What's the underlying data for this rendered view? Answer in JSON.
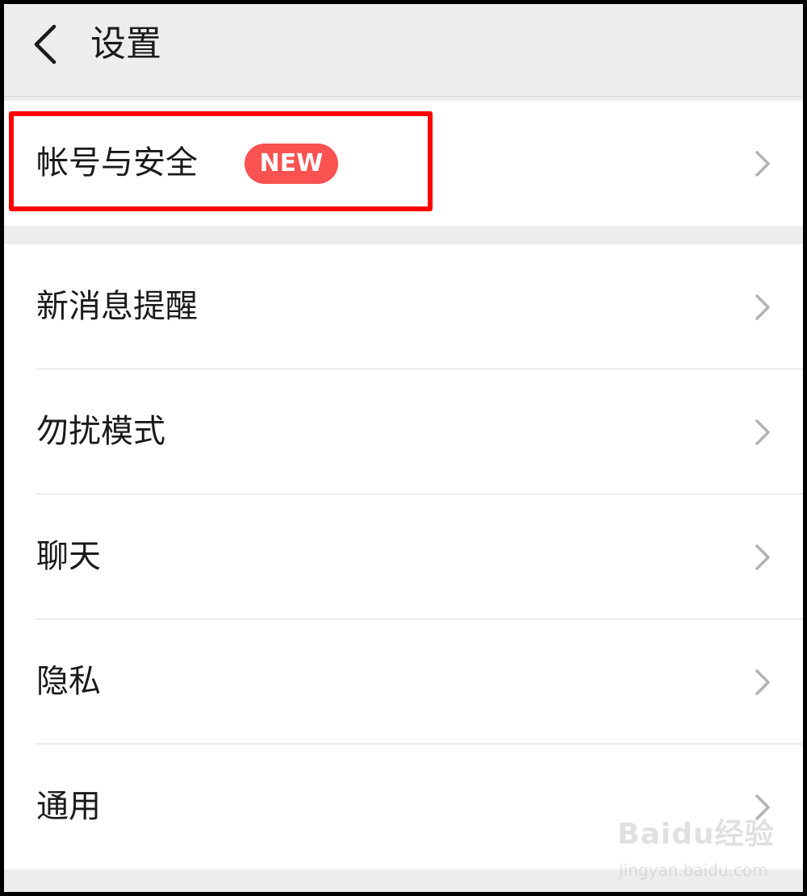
{
  "header": {
    "title": "设置",
    "back_icon": "chevron-left-icon"
  },
  "account_group": {
    "label": "帐号与安全",
    "badge": "NEW",
    "badge_color": "#fa5151"
  },
  "settings_group": {
    "items": [
      {
        "label": "新消息提醒"
      },
      {
        "label": "勿扰模式"
      },
      {
        "label": "聊天"
      },
      {
        "label": "隐私"
      },
      {
        "label": "通用"
      }
    ]
  },
  "annotation": {
    "highlight_color": "#ff0000"
  },
  "watermark": {
    "brand": "Baidu经验",
    "url": "jingyan.baidu.com"
  }
}
